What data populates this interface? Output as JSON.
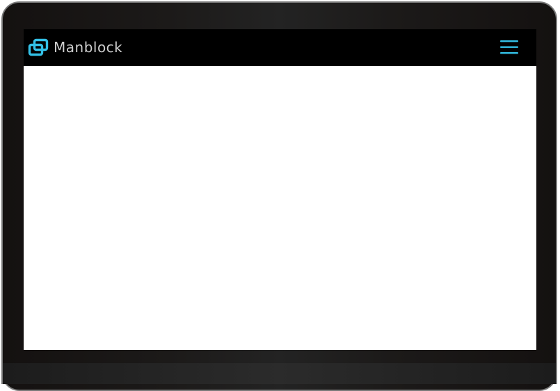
{
  "app": {
    "brand_name": "Manblock",
    "logo_icon": "linked-blocks-logo-icon",
    "menu_icon": "hamburger-menu-icon"
  },
  "colors": {
    "accent": "#33c0e6",
    "navbar_background": "#000000",
    "brand_text": "#cfcfcf",
    "content_background": "#ffffff",
    "device_frame": "#1c1a19"
  }
}
